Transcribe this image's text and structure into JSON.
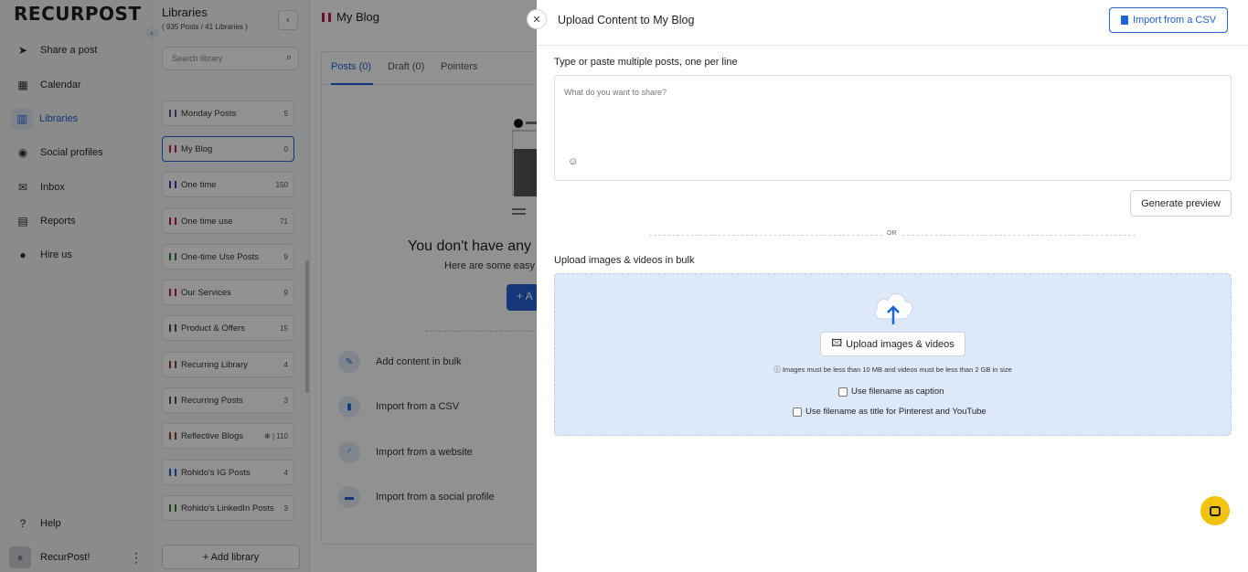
{
  "brand": {
    "logo": "RECURPOST"
  },
  "nav": {
    "items": [
      {
        "label": "Share a post",
        "icon": "send-icon"
      },
      {
        "label": "Calendar",
        "icon": "calendar-icon"
      },
      {
        "label": "Libraries",
        "icon": "library-icon",
        "active": true
      },
      {
        "label": "Social profiles",
        "icon": "profile-icon"
      },
      {
        "label": "Inbox",
        "icon": "inbox-icon"
      },
      {
        "label": "Reports",
        "icon": "reports-icon"
      },
      {
        "label": "Hire us",
        "icon": "person-icon"
      }
    ],
    "help": "Help",
    "user": "RecurPost!"
  },
  "libraries": {
    "title": "Libraries",
    "subtitle": "( 935 Posts / 41 Libraries )",
    "search_placeholder": "Search library",
    "items": [
      {
        "name": "Monday Posts",
        "count": "5",
        "color": "#6b4f9e"
      },
      {
        "name": "My Blog",
        "count": "0",
        "color": "#c2185b",
        "selected": true
      },
      {
        "name": "One time",
        "count": "150",
        "color": "#3b3bb8"
      },
      {
        "name": "One time use",
        "count": "71",
        "color": "#c2185b"
      },
      {
        "name": "One-time Use Posts",
        "count": "9",
        "color": "#2e7d32"
      },
      {
        "name": "Our Services",
        "count": "9",
        "color": "#c2185b"
      },
      {
        "name": "Product & Offers",
        "count": "15",
        "color": "#444444"
      },
      {
        "name": "Recurring Library",
        "count": "4",
        "color": "#8b3a2a"
      },
      {
        "name": "Recurring Posts",
        "count": "3",
        "color": "#555555"
      },
      {
        "name": "Reflective Blogs",
        "count": "✻ | 110",
        "color": "#8b3a2a"
      },
      {
        "name": "Rohido's IG Posts",
        "count": "4",
        "color": "#1e62d6"
      },
      {
        "name": "Rohido's LinkedIn Posts",
        "count": "3",
        "color": "#2e7d32"
      }
    ],
    "add_label": "+ Add library"
  },
  "main": {
    "title": "My Blog",
    "tabs": [
      "Posts (0)",
      "Draft (0)",
      "Pointers"
    ],
    "empty_title": "You don't have any",
    "empty_sub": "Here are some easy",
    "empty_btn": "+ A",
    "options": [
      {
        "label": "Add content in bulk",
        "icon": "pencil-icon"
      },
      {
        "label": "Import from a CSV",
        "icon": "csv-file-icon"
      },
      {
        "label": "Import from a website",
        "icon": "rss-icon"
      },
      {
        "label": "Import from a social profile",
        "icon": "chat-icon"
      }
    ]
  },
  "drawer": {
    "title": "Upload Content to My Blog",
    "csv_button": "Import from a CSV",
    "text_section_label": "Type or paste multiple posts, one per line",
    "text_placeholder": "What do you want to share?",
    "generate_button": "Generate preview",
    "or_text": "OR",
    "upload_section_label": "Upload images & videos in bulk",
    "upload_button": "Upload images & videos",
    "upload_note": "Images must be less than 10 MB and videos must be less than 2 GB in size",
    "checkbox_caption": "Use filename as caption",
    "checkbox_title": "Use filename as title for Pinterest and YouTube"
  },
  "colors": {
    "accent": "#1e62d6",
    "dropzone": "#dde8f8",
    "chat": "#f2c30c"
  }
}
